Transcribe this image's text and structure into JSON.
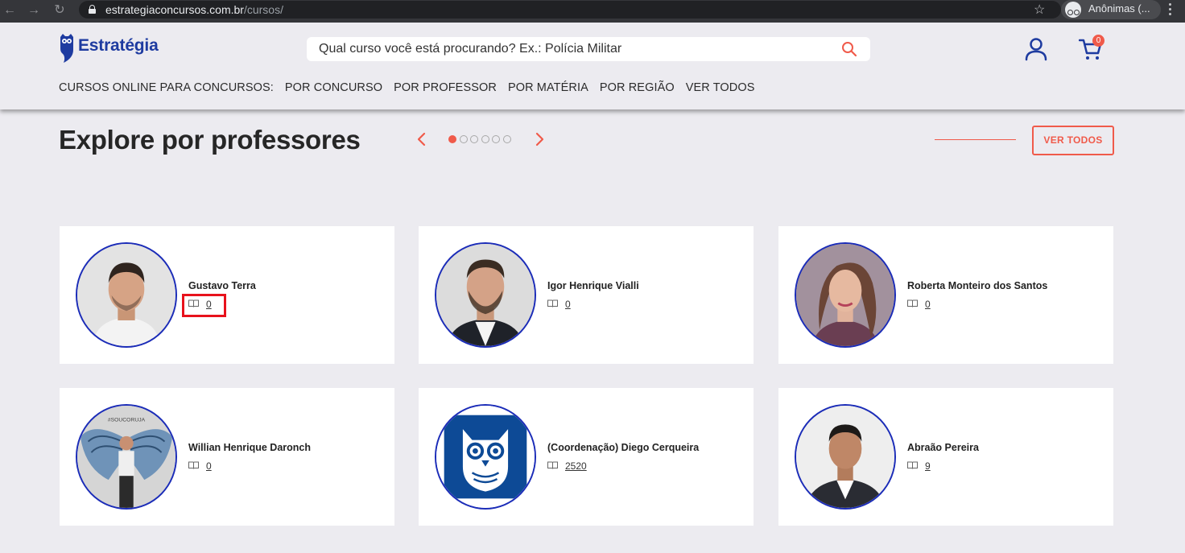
{
  "browser": {
    "url_host": "estrategiaconcursos.com.br",
    "url_path": "/cursos/",
    "profile_label": "Anônimas (..."
  },
  "header": {
    "logo_text": "Estratégia",
    "search_placeholder": "Qual curso você está procurando? Ex.: Polícia Militar",
    "cart_count": "0",
    "nav": [
      "CURSOS ONLINE PARA CONCURSOS:",
      "POR CONCURSO",
      "POR PROFESSOR",
      "POR MATÉRIA",
      "POR REGIÃO",
      "VER TODOS"
    ]
  },
  "section": {
    "title": "Explore por professores",
    "carousel_pages": 6,
    "carousel_active_page": 1,
    "ver_todos_label": "VER TODOS"
  },
  "professors": [
    {
      "name": "Gustavo Terra",
      "courses": "0"
    },
    {
      "name": "Igor Henrique Vialli",
      "courses": "0"
    },
    {
      "name": "Roberta Monteiro dos Santos",
      "courses": "0"
    },
    {
      "name": "Willian Henrique Daronch",
      "courses": "0"
    },
    {
      "name": "(Coordenação) Diego Cerqueira",
      "courses": "2520"
    },
    {
      "name": "Abraão Pereira",
      "courses": "9"
    }
  ],
  "colors": {
    "brand_blue": "#1e3ba0",
    "accent_coral": "#f05a4a",
    "avatar_border": "#1b2cb8",
    "highlight_red": "#e8121c"
  }
}
